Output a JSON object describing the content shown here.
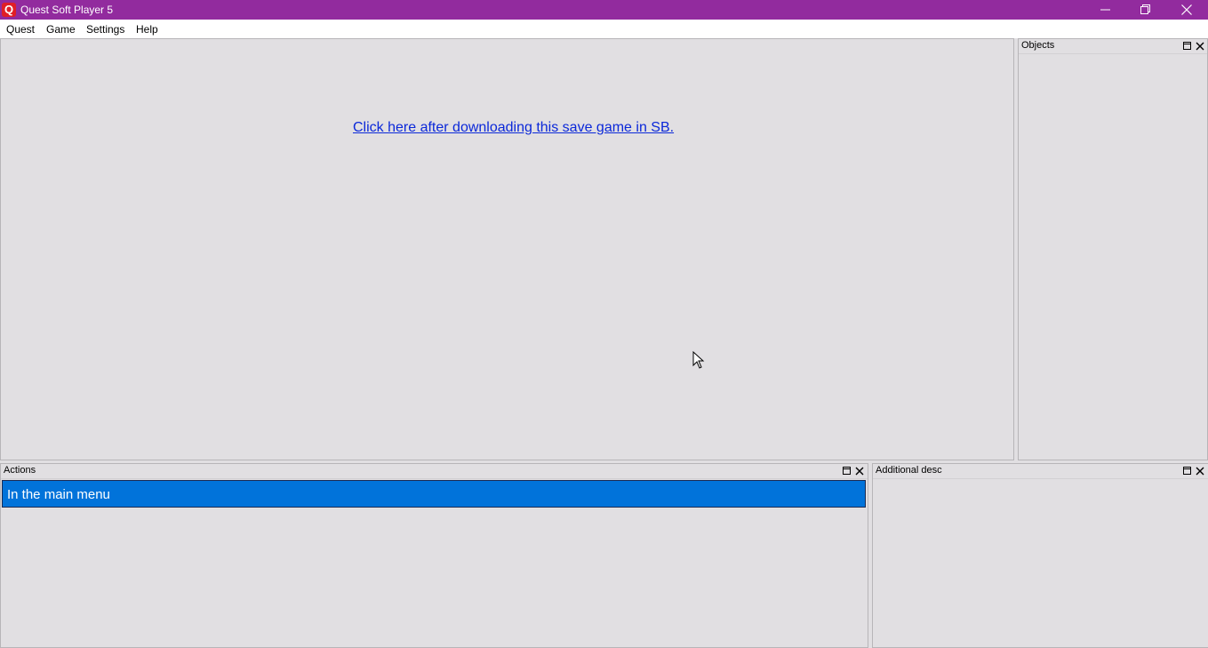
{
  "window": {
    "title": "Quest Soft Player 5",
    "icon": "quest-q-icon",
    "icon_letter": "Q",
    "titlebar_color": "#922b9e",
    "controls": [
      "minimize-icon",
      "restore-icon",
      "close-icon"
    ]
  },
  "menu": {
    "items": [
      "Quest",
      "Game",
      "Settings",
      "Help"
    ]
  },
  "main": {
    "link_text": "Click here after downloading this save game in SB.",
    "link_color": "#0b28d9"
  },
  "docks": {
    "objects": {
      "title": "Objects"
    },
    "actions": {
      "title": "Actions",
      "items": [
        "In the main menu"
      ],
      "selected_color": "#0173da"
    },
    "additional_desc": {
      "title": "Additional desc"
    }
  }
}
